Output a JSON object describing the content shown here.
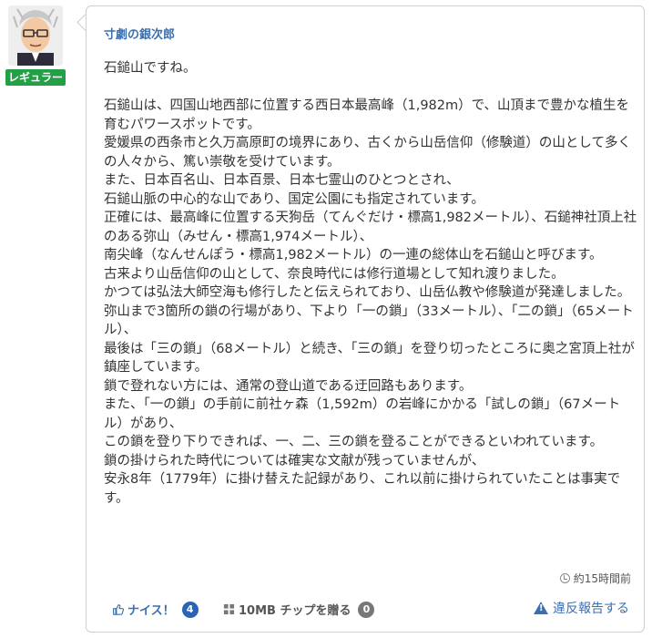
{
  "author": {
    "badge": "レギュラー",
    "name": "寸劇の銀次郎"
  },
  "post": {
    "lines": [
      "石鎚山ですね。",
      "",
      "石鎚山は、四国山地西部に位置する西日本最高峰（1,982m）で、山頂まで豊かな植生を育むパワースポットです。",
      "愛媛県の西条市と久万高原町の境界にあり、古くから山岳信仰（修験道）の山として多くの人々から、篤い崇敬を受けています。",
      "また、日本百名山、日本百景、日本七霊山のひとつとされ、",
      "石鎚山脈の中心的な山であり、国定公園にも指定されています。",
      "正確には、最高峰に位置する天狗岳（てんぐだけ・標高1,982メートル）、石鎚神社頂上社のある弥山（みせん・標高1,974メートル）、",
      "南尖峰（なんせんぽう・標高1,982メートル）の一連の総体山を石鎚山と呼びます。",
      "古来より山岳信仰の山として、奈良時代には修行道場として知れ渡りました。",
      "かつては弘法大師空海も修行したと伝えられており、山岳仏教や修験道が発達しました。",
      "弥山まで3箇所の鎖の行場があり、下より「一の鎖」（33メートル）、「二の鎖」（65メートル）、",
      "最後は「三の鎖」（68メートル）と続き、「三の鎖」を登り切ったところに奥之宮頂上社が鎮座しています。",
      "鎖で登れない方には、通常の登山道である迂回路もあります。",
      "また、「一の鎖」の手前に前社ヶ森（1,592m）の岩峰にかかる「試しの鎖」（67メートル）があり、",
      "この鎖を登り下りできれば、一、二、三の鎖を登ることができるといわれています。",
      "鎖の掛けられた時代については確実な文献が残っていませんが、",
      "安永8年（1779年）に掛け替えた記録があり、これ以前に掛けられていたことは事実です。"
    ],
    "time": "約15時間前"
  },
  "actions": {
    "like_label": "ナイス！",
    "like_count": "4",
    "chip_label": "10MB チップを贈る",
    "chip_count": "0",
    "report_label": "違反報告する"
  },
  "colors": {
    "accent": "#3a6fb0",
    "badge_green": "#23a045",
    "like_badge": "#2b63b5",
    "chip_badge": "#777777"
  },
  "icons": {
    "like": "thumbs-up-icon",
    "chip": "chip-grid-icon",
    "time": "clock-icon",
    "report": "warning-triangle-icon"
  }
}
